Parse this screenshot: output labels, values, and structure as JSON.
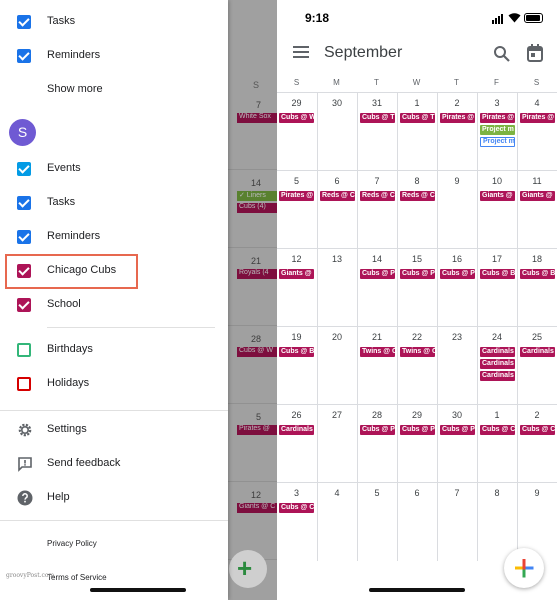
{
  "drawer": {
    "top_items": [
      {
        "label": "Tasks",
        "color": "#1a73e8",
        "style": "filled",
        "icon": "check-icon"
      },
      {
        "label": "Reminders",
        "color": "#1a73e8",
        "style": "filled",
        "icon": "check-icon"
      }
    ],
    "show_more": "Show more",
    "account_initial": "S",
    "calendars": [
      {
        "label": "Events",
        "color": "#039be5",
        "style": "filled"
      },
      {
        "label": "Tasks",
        "color": "#1a73e8",
        "style": "filled"
      },
      {
        "label": "Reminders",
        "color": "#1a73e8",
        "style": "filled"
      },
      {
        "label": "Chicago Cubs",
        "color": "#ad1457",
        "style": "filled",
        "highlighted": true
      },
      {
        "label": "School",
        "color": "#ad1457",
        "style": "filled"
      }
    ],
    "other_calendars": [
      {
        "label": "Birthdays",
        "color": "#33b679",
        "style": "outline"
      },
      {
        "label": "Holidays",
        "color": "#d50000",
        "style": "outline"
      }
    ],
    "menu": [
      {
        "label": "Settings",
        "icon": "gear-icon"
      },
      {
        "label": "Send feedback",
        "icon": "feedback-icon"
      },
      {
        "label": "Help",
        "icon": "help-icon"
      }
    ],
    "privacy_policy": "Privacy Policy",
    "terms": "Terms of Service",
    "watermark": "groovyPost.com"
  },
  "dimmed_calendar": {
    "weeks": [
      {
        "num": "7",
        "chip": "White Sox",
        "chip_color": "#ad1457"
      },
      {
        "num": "14",
        "chip": "✓ Liners",
        "chip_color": "#7cb342",
        "chip2": "Cubs (4)",
        "chip2_color": "#ad1457"
      },
      {
        "num": "21",
        "chip": "Royals (4",
        "chip_color": "#ad1457"
      },
      {
        "num": "28",
        "chip": "Cubs @ W",
        "chip_color": "#ad1457"
      },
      {
        "num": "5",
        "chip": "Pirates @",
        "chip_color": "#ad1457"
      },
      {
        "num": "12",
        "chip": "Giants @ C",
        "chip_color": "#ad1457"
      }
    ],
    "day_letter": "S"
  },
  "status_bar": {
    "time": "9:18"
  },
  "header": {
    "month": "September"
  },
  "day_headers": [
    "S",
    "M",
    "T",
    "W",
    "T",
    "F",
    "S"
  ],
  "weeks": [
    {
      "days": [
        {
          "n": "29",
          "events": [
            {
              "t": "Cubs @ W",
              "c": "#ad1457"
            }
          ]
        },
        {
          "n": "30",
          "events": []
        },
        {
          "n": "31",
          "events": [
            {
              "t": "Cubs @ T",
              "c": "#ad1457"
            }
          ]
        },
        {
          "n": "1",
          "events": [
            {
              "t": "Cubs @ T",
              "c": "#ad1457"
            }
          ]
        },
        {
          "n": "2",
          "events": [
            {
              "t": "Pirates @",
              "c": "#ad1457"
            }
          ]
        },
        {
          "n": "3",
          "events": [
            {
              "t": "Pirates @",
              "c": "#ad1457"
            },
            {
              "t": "Project m",
              "c": "#7cb342"
            },
            {
              "t": "Project m",
              "c": "#4285f4",
              "outline": true
            }
          ]
        },
        {
          "n": "4",
          "events": [
            {
              "t": "Pirates @",
              "c": "#ad1457"
            }
          ]
        }
      ]
    },
    {
      "days": [
        {
          "n": "5",
          "events": [
            {
              "t": "Pirates @",
              "c": "#ad1457"
            }
          ]
        },
        {
          "n": "6",
          "events": [
            {
              "t": "Reds @ C",
              "c": "#ad1457"
            }
          ]
        },
        {
          "n": "7",
          "events": [
            {
              "t": "Reds @ C",
              "c": "#ad1457"
            }
          ]
        },
        {
          "n": "8",
          "events": [
            {
              "t": "Reds @ C",
              "c": "#ad1457"
            }
          ]
        },
        {
          "n": "9",
          "events": []
        },
        {
          "n": "10",
          "events": [
            {
              "t": "Giants @",
              "c": "#ad1457"
            }
          ]
        },
        {
          "n": "11",
          "events": [
            {
              "t": "Giants @",
              "c": "#ad1457"
            }
          ]
        }
      ]
    },
    {
      "days": [
        {
          "n": "12",
          "events": [
            {
              "t": "Giants @",
              "c": "#ad1457"
            }
          ]
        },
        {
          "n": "13",
          "events": []
        },
        {
          "n": "14",
          "events": [
            {
              "t": "Cubs @ P",
              "c": "#ad1457"
            }
          ]
        },
        {
          "n": "15",
          "events": [
            {
              "t": "Cubs @ P",
              "c": "#ad1457"
            }
          ]
        },
        {
          "n": "16",
          "events": [
            {
              "t": "Cubs @ P",
              "c": "#ad1457"
            }
          ]
        },
        {
          "n": "17",
          "events": [
            {
              "t": "Cubs @ B",
              "c": "#ad1457"
            }
          ]
        },
        {
          "n": "18",
          "events": [
            {
              "t": "Cubs @ B",
              "c": "#ad1457"
            }
          ]
        }
      ]
    },
    {
      "days": [
        {
          "n": "19",
          "events": [
            {
              "t": "Cubs @ B",
              "c": "#ad1457"
            }
          ]
        },
        {
          "n": "20",
          "events": []
        },
        {
          "n": "21",
          "events": [
            {
              "t": "Twins @ C",
              "c": "#ad1457"
            }
          ]
        },
        {
          "n": "22",
          "events": [
            {
              "t": "Twins @ C",
              "c": "#ad1457"
            }
          ]
        },
        {
          "n": "23",
          "events": []
        },
        {
          "n": "24",
          "events": [
            {
              "t": "Cardinals",
              "c": "#ad1457"
            },
            {
              "t": "Cardinals",
              "c": "#ad1457"
            },
            {
              "t": "Cardinals",
              "c": "#ad1457"
            }
          ]
        },
        {
          "n": "25",
          "events": [
            {
              "t": "Cardinals",
              "c": "#ad1457"
            }
          ]
        }
      ]
    },
    {
      "days": [
        {
          "n": "26",
          "events": [
            {
              "t": "Cardinals",
              "c": "#ad1457"
            }
          ]
        },
        {
          "n": "27",
          "events": []
        },
        {
          "n": "28",
          "events": [
            {
              "t": "Cubs @ P",
              "c": "#ad1457"
            }
          ]
        },
        {
          "n": "29",
          "events": [
            {
              "t": "Cubs @ P",
              "c": "#ad1457"
            }
          ]
        },
        {
          "n": "30",
          "events": [
            {
              "t": "Cubs @ P",
              "c": "#ad1457"
            }
          ]
        },
        {
          "n": "1",
          "events": [
            {
              "t": "Cubs @ C",
              "c": "#ad1457"
            }
          ]
        },
        {
          "n": "2",
          "events": [
            {
              "t": "Cubs @ C",
              "c": "#ad1457"
            }
          ]
        }
      ]
    },
    {
      "days": [
        {
          "n": "3",
          "events": [
            {
              "t": "Cubs @ C",
              "c": "#ad1457"
            }
          ]
        },
        {
          "n": "4",
          "events": []
        },
        {
          "n": "5",
          "events": []
        },
        {
          "n": "6",
          "events": []
        },
        {
          "n": "7",
          "events": []
        },
        {
          "n": "8",
          "events": []
        },
        {
          "n": "9",
          "events": []
        }
      ]
    }
  ],
  "fab": {
    "icon": "plus-icon"
  }
}
